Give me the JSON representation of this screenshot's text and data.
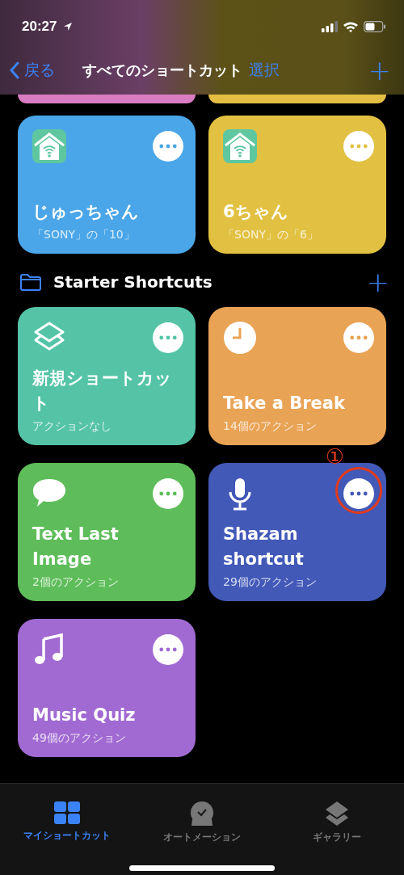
{
  "status_bar": {
    "time": "20:27"
  },
  "nav": {
    "back": "戻る",
    "title": "すべてのショートカット",
    "select": "選択",
    "add": "+"
  },
  "partial_cards": [
    {
      "color": "#d97cc2"
    },
    {
      "color": "#e3be42"
    }
  ],
  "top_cards": [
    {
      "title": "じゅっちゃん",
      "subtitle": "「SONY」の「10」",
      "kind": "home",
      "color": "#4aa6e8"
    },
    {
      "title": "6ちゃん",
      "subtitle": "「SONY」の「6」",
      "kind": "home",
      "color": "#e2c142"
    }
  ],
  "folder": {
    "title": "Starter Shortcuts",
    "add": "+"
  },
  "cards": [
    {
      "title": "新規ショートカット",
      "subtitle": "アクションなし",
      "kind": "layers",
      "color": "#55c4a6"
    },
    {
      "title": "Take a Break",
      "subtitle": "14個のアクション",
      "kind": "clock",
      "color": "#e9a355"
    },
    {
      "title": "Text Last Image",
      "subtitle": "2個のアクション",
      "kind": "message",
      "color": "#5ebd5a"
    },
    {
      "title": "Shazam shortcut",
      "subtitle": "29個のアクション",
      "kind": "mic",
      "color": "#4259b8",
      "callout": "①"
    },
    {
      "title": "Music Quiz",
      "subtitle": "49個のアクション",
      "kind": "music",
      "color": "#a16ad2"
    }
  ],
  "tabs": [
    {
      "label": "マイショートカット",
      "kind": "grid",
      "selected": true
    },
    {
      "label": "オートメーション",
      "kind": "clock",
      "selected": false
    },
    {
      "label": "ギャラリー",
      "kind": "layers",
      "selected": false
    }
  ]
}
